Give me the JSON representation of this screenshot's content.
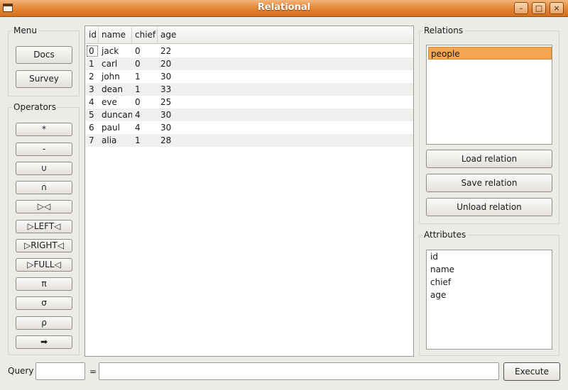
{
  "window": {
    "title": "Relational"
  },
  "menu": {
    "title": "Menu",
    "docs_label": "Docs",
    "survey_label": "Survey"
  },
  "operators": {
    "title": "Operators",
    "items": [
      "*",
      "-",
      "∪",
      "∩",
      "▷◁",
      "▷LEFT◁",
      "▷RIGHT◁",
      "▷FULL◁",
      "π",
      "σ",
      "ρ",
      "➡"
    ]
  },
  "table": {
    "headers": [
      "id",
      "name",
      "chief",
      "age"
    ],
    "rows": [
      [
        "0",
        "jack",
        "0",
        "22"
      ],
      [
        "1",
        "carl",
        "0",
        "20"
      ],
      [
        "2",
        "john",
        "1",
        "30"
      ],
      [
        "3",
        "dean",
        "1",
        "33"
      ],
      [
        "4",
        "eve",
        "0",
        "25"
      ],
      [
        "5",
        "duncan",
        "4",
        "30"
      ],
      [
        "6",
        "paul",
        "4",
        "30"
      ],
      [
        "7",
        "alia",
        "1",
        "28"
      ]
    ]
  },
  "relations": {
    "title": "Relations",
    "items": [
      "people"
    ],
    "selected": "people",
    "load_label": "Load relation",
    "save_label": "Save relation",
    "unload_label": "Unload relation"
  },
  "attributes": {
    "title": "Attributes",
    "items": [
      "id",
      "name",
      "chief",
      "age"
    ]
  },
  "query": {
    "label": "Query",
    "name_value": "",
    "equals": "=",
    "expression_value": "",
    "execute_label": "Execute"
  },
  "colors": {
    "titlebar": "#e48a3c",
    "selection": "#f5a650"
  }
}
